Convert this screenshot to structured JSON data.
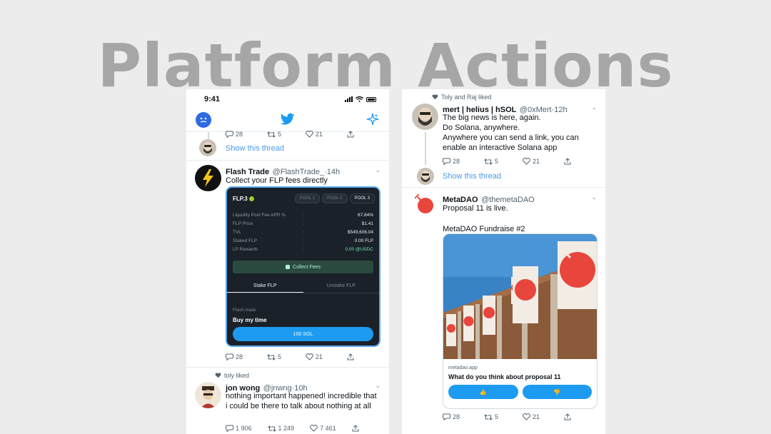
{
  "hero": {
    "title": "Platform Actions"
  },
  "left_phone": {
    "status": {
      "time": "9:41"
    },
    "thread_stub": {
      "actions": {
        "replies": "28",
        "retweets": "5",
        "likes": "21"
      },
      "show_thread": "Show this thread"
    },
    "flash_tweet": {
      "name": "Flash Trade",
      "handle": "@FlashTrade_",
      "time": "·14h",
      "text": "Collect your FLP fees directly",
      "card": {
        "logo": "FLP.3",
        "pools": [
          "POOL 1",
          "POOL 2",
          "POOL 3"
        ],
        "rows": [
          {
            "k": "Liquidity Pool Fee APR %",
            "c": ":",
            "v": "67.84%"
          },
          {
            "k": "FLP Price",
            "c": ":",
            "v": "$1.41"
          },
          {
            "k": "TVL",
            "c": ":",
            "v": "$549,606.04"
          },
          {
            "k": "Staked FLP",
            "c": ":",
            "v": "0.00 FLP"
          },
          {
            "k": "LP Rewards",
            "c": ":",
            "v": "0.00 @USDC"
          }
        ],
        "collect_label": "Collect Fees",
        "tab_stake": "Stake FLP",
        "tab_unstake": "Unstake FLP",
        "site": "Flash.trade",
        "caption": "Buy my time",
        "buy_label": "100 SOL"
      },
      "actions": {
        "replies": "28",
        "retweets": "5",
        "likes": "21"
      }
    },
    "jon_tweet": {
      "liked_by": "toly liked",
      "name": "jon wong",
      "handle": "@jnwng",
      "time": "·10h",
      "text": "nothing important happened! incredible that i could be there to talk about nothing at all",
      "actions": {
        "replies": "1 906",
        "retweets": "1 249",
        "likes": "7 461"
      }
    }
  },
  "right_phone": {
    "mert_tweet": {
      "liked_by": "Toly and Raj liked",
      "name": "mert | helius | hSOL",
      "handle": "@0xMert",
      "time": "·12h",
      "text_lines": [
        "The big news is here, again.",
        "Do Solana, anywhere.",
        "Anywhere you can send a link, you can enable an interactive Solana app"
      ],
      "actions": {
        "replies": "28",
        "retweets": "5",
        "likes": "21"
      },
      "show_thread": "Show this thread"
    },
    "metadao_tweet": {
      "name": "MetaDAO",
      "handle": "@themetaDAO",
      "text_1": "Proposal 11 is live.",
      "text_2": "MetaDAO Fundraise #2",
      "card": {
        "site": "metadao.app",
        "title": "What do you think about proposal 11",
        "btn_up": "👍",
        "btn_down": "👎"
      },
      "actions": {
        "replies": "28",
        "retweets": "5",
        "likes": "21"
      }
    }
  },
  "colors": {
    "accent": "#1d9bf0",
    "link": "#4a99e9",
    "metadao_red": "#e8453c"
  }
}
